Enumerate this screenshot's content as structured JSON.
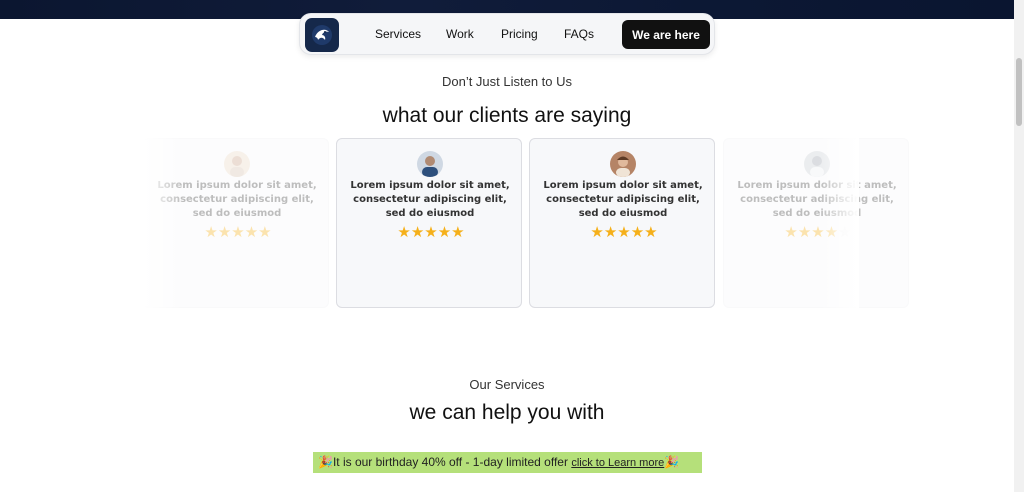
{
  "nav": {
    "links": [
      "Services",
      "Work",
      "Pricing",
      "FAQs"
    ],
    "cta_label": "We are here"
  },
  "testimonials": {
    "eyebrow": "Don’t Just Listen to Us",
    "heading": "what our clients are saying",
    "cards": [
      {
        "text": "Lorem ipsum dolor sit amet, consectetur adipiscing elit, sed do eiusmod",
        "rating": 5
      },
      {
        "text": "Lorem ipsum dolor sit amet, consectetur adipiscing elit, sed do eiusmod",
        "rating": 5
      },
      {
        "text": "Lorem ipsum dolor sit amet, consectetur adipiscing elit, sed do eiusmod",
        "rating": 5
      },
      {
        "text": "Lorem ipsum dolor sit amet, consectetur adipiscing elit, sed do eiusmod",
        "rating": 4
      }
    ]
  },
  "services": {
    "eyebrow": "Our Services",
    "heading": "we can help you with"
  },
  "offer": {
    "text": "It is our birthday 40% off - 1-day limited offer",
    "link_label": "click to Learn more",
    "icon_left": "🎉",
    "icon_right": "🎉"
  },
  "colors": {
    "accent_star": "#f5b01a",
    "cta_bg": "#111111",
    "offer_bg": "#b5e07a",
    "logo_bg": "#15284a"
  }
}
